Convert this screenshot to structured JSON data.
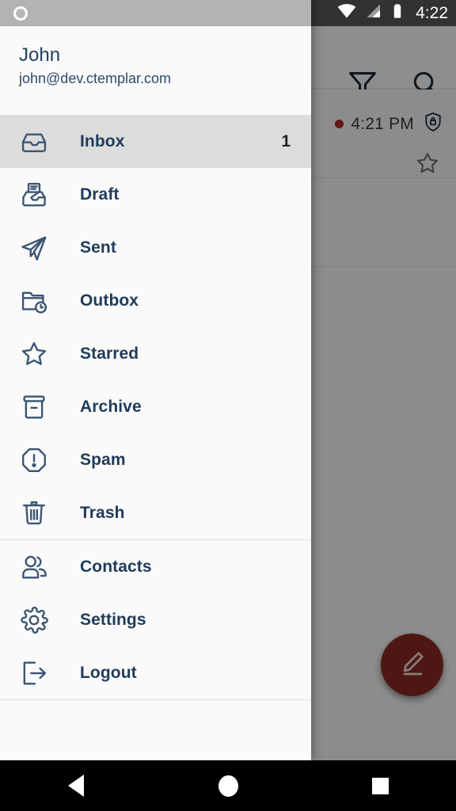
{
  "status_bar": {
    "time": "4:22",
    "icons": [
      "notification-dot-icon",
      "wifi-icon",
      "cellular-signal-icon",
      "battery-icon"
    ]
  },
  "app_background": {
    "toolbar": {
      "filter_icon": "filter-funnel-icon",
      "search_icon": "search-icon"
    },
    "mail_list": {
      "rows": [
        {
          "unread": true,
          "time": "4:21 PM",
          "encryption_icon": "shield-lock-icon",
          "star_icon": "star-outline-icon"
        }
      ]
    },
    "compose_fab": {
      "label": "Compose",
      "icon": "pencil-compose-icon",
      "color": "#8e2a22"
    }
  },
  "drawer": {
    "account": {
      "name": "John",
      "email": "john@dev.ctemplar.com"
    },
    "folders": [
      {
        "label": "Inbox",
        "icon": "inbox-tray-icon",
        "badge": "1",
        "selected": true
      },
      {
        "label": "Draft",
        "icon": "draft-tray-icon",
        "badge": "",
        "selected": false
      },
      {
        "label": "Sent",
        "icon": "paper-plane-icon",
        "badge": "",
        "selected": false
      },
      {
        "label": "Outbox",
        "icon": "folder-clock-icon",
        "badge": "",
        "selected": false
      },
      {
        "label": "Starred",
        "icon": "star-outline-icon",
        "badge": "",
        "selected": false
      },
      {
        "label": "Archive",
        "icon": "archive-box-icon",
        "badge": "",
        "selected": false
      },
      {
        "label": "Spam",
        "icon": "spam-octagon-icon",
        "badge": "",
        "selected": false
      },
      {
        "label": "Trash",
        "icon": "trash-can-icon",
        "badge": "",
        "selected": false
      }
    ],
    "actions": [
      {
        "label": "Contacts",
        "icon": "contacts-people-icon"
      },
      {
        "label": "Settings",
        "icon": "gear-icon"
      },
      {
        "label": "Logout",
        "icon": "logout-arrow-icon"
      }
    ],
    "accent_text_color": "#1f3b59",
    "selected_row_color": "#dcdcdc"
  },
  "android_navbar": {
    "back": "Back",
    "home": "Home",
    "recents": "Recents"
  }
}
